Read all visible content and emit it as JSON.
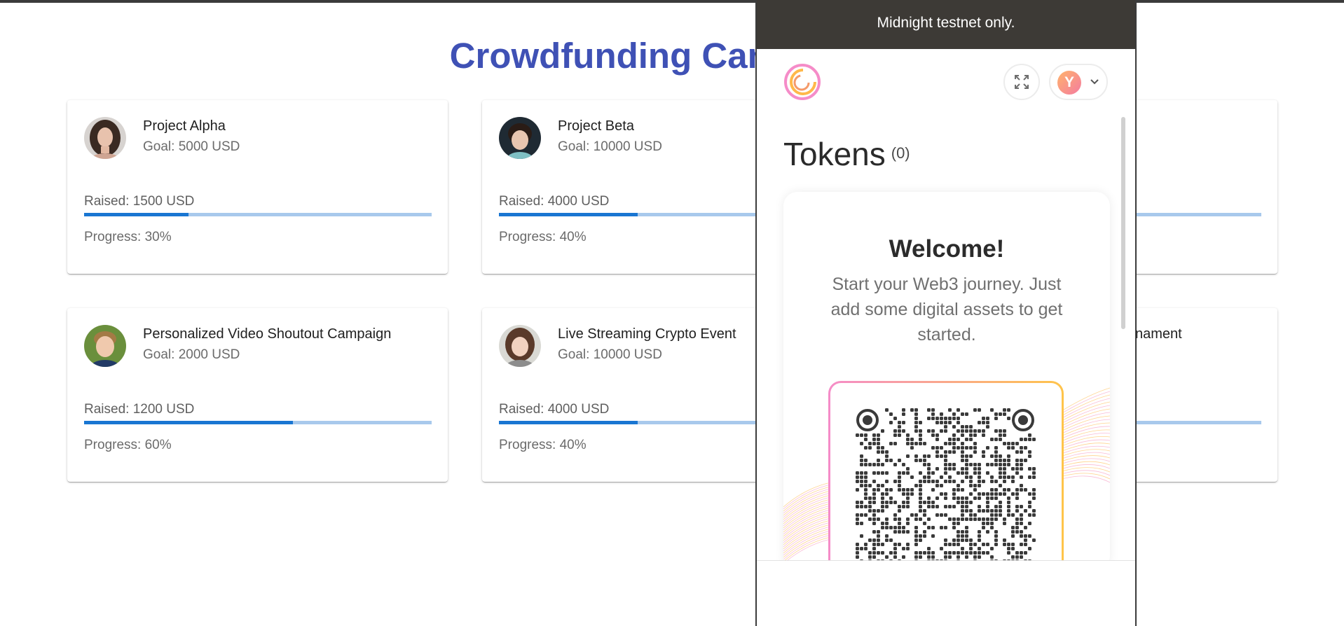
{
  "page": {
    "title": "Crowdfunding Campaigns"
  },
  "campaigns": [
    {
      "title": "Project Alpha",
      "goal": "Goal: 5000 USD",
      "raised": "Raised: 1500 USD",
      "progress_label": "Progress: 30%",
      "progress": 0.3
    },
    {
      "title": "Project Beta",
      "goal": "Goal: 10000 USD",
      "raised": "Raised: 4000 USD",
      "progress_label": "Progress: 40%",
      "progress": 0.4
    },
    {
      "title": "",
      "goal": "",
      "raised": "",
      "progress_label": "",
      "progress": 0.4
    },
    {
      "title": "Personalized Video Shoutout Campaign",
      "goal": "Goal: 2000 USD",
      "raised": "Raised: 1200 USD",
      "progress_label": "Progress: 60%",
      "progress": 0.6
    },
    {
      "title": "Live Streaming Crypto Event",
      "goal": "Goal: 10000 USD",
      "raised": "Raised: 4000 USD",
      "progress_label": "Progress: 40%",
      "progress": 0.4
    },
    {
      "title": "nament",
      "goal": "",
      "raised": "",
      "progress_label": "",
      "progress": 0.4
    }
  ],
  "wallet": {
    "banner": "Midnight testnet only.",
    "account_initial": "Y",
    "tokens_heading": "Tokens",
    "tokens_count": "(0)",
    "welcome_title": "Welcome!",
    "welcome_desc": "Start your Web3 journey. Just add some digital assets to get started.",
    "icons": {
      "logo": "wallet-logo-icon",
      "expand": "expand-icon",
      "chevron": "chevron-down-icon"
    },
    "colors": {
      "banner_bg": "#3d3a36",
      "accent_pink": "#f58cc8",
      "accent_yellow": "#ffc44a"
    }
  },
  "colors": {
    "title": "#3f51b5",
    "progress_fill": "#1976d2",
    "progress_track": "#a8c9ec"
  }
}
